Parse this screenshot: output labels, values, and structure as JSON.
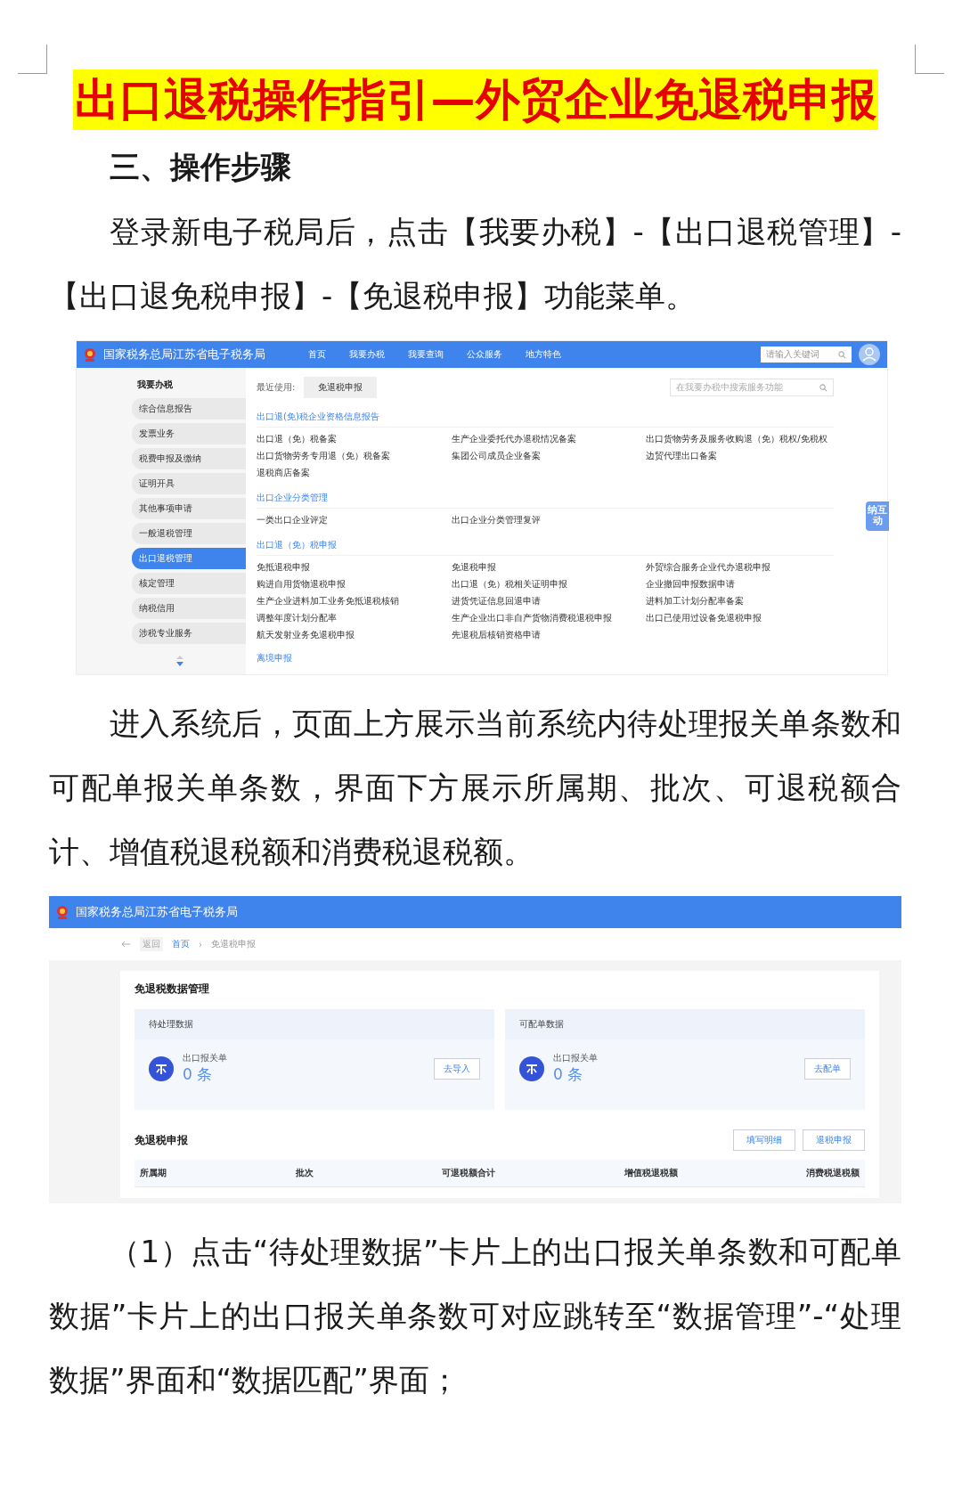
{
  "title": "出口退税操作指引—外贸企业免退税申报",
  "heading": "三、操作步骤",
  "paragraph_1": "登录新电子税局后，点击【我要办税】-【出口退税管理】-【出口退免税申报】-【免退税申报】功能菜单。",
  "screenshot_1": {
    "header": {
      "site_title": "国家税务总局江苏省电子税务局",
      "nav": [
        "首页",
        "我要办税",
        "我要查询",
        "公众服务",
        "地方特色"
      ],
      "search": {
        "placeholder": "请输入关键词"
      }
    },
    "sidebar": {
      "title": "我要办税",
      "items": [
        {
          "label": "综合信息报告",
          "selected": false
        },
        {
          "label": "发票业务",
          "selected": false
        },
        {
          "label": "税费申报及缴纳",
          "selected": false
        },
        {
          "label": "证明开具",
          "selected": false
        },
        {
          "label": "其他事项申请",
          "selected": false
        },
        {
          "label": "一般退税管理",
          "selected": false
        },
        {
          "label": "出口退税管理",
          "selected": true
        },
        {
          "label": "核定管理",
          "selected": false
        },
        {
          "label": "纳税信用",
          "selected": false
        },
        {
          "label": "涉税专业服务",
          "selected": false
        }
      ]
    },
    "recent": {
      "label": "最近使用:",
      "item": "免退税申报"
    },
    "search": {
      "placeholder": "在我要办税中搜索服务功能"
    },
    "sections": [
      {
        "title": "出口退(免)税企业资格信息报告",
        "items": [
          "出口退（免）税备案",
          "生产企业委托代办退税情况备案",
          "出口货物劳务及服务收购退（免）税权/免税权",
          "出口货物劳务专用退（免）税备案",
          "集团公司成员企业备案",
          "边贸代理出口备案",
          "退税商店备案"
        ]
      },
      {
        "title": "出口企业分类管理",
        "items": [
          "一类出口企业评定",
          "出口企业分类管理复评"
        ]
      },
      {
        "title": "出口退（免）税申报",
        "items": [
          "免抵退税申报",
          "免退税申报",
          "外贸综合服务企业代办退税申报",
          "购进自用货物退税申报",
          "出口退（免）税相关证明申报",
          "企业撤回申报数据申请",
          "生产企业进料加工业务免抵退税核销",
          "进货凭证信息回退申请",
          "进料加工计划分配率备案",
          "调整年度计划分配率",
          "生产企业出口非自产货物消费税退税申报",
          "出口已使用过设备免退税申报",
          "航天发射业务免退税申报",
          "先退税后核销资格申请"
        ]
      }
    ],
    "more_link": "离境申报",
    "float_badge": "纳互动"
  },
  "paragraph_2": "进入系统后，页面上方展示当前系统内待处理报关单条数和可配单报关单条数，界面下方展示所属期、批次、可退税额合计、增值税退税额和消费税退税额。",
  "screenshot_2": {
    "header": {
      "site_title": "国家税务总局江苏省电子税务局"
    },
    "breadcrumb": {
      "back": "返回",
      "separator": "›",
      "items": [
        "首页",
        "免退税申报"
      ]
    },
    "data_panel": {
      "title": "免退税数据管理",
      "cards": [
        {
          "title": "待处理数据",
          "label": "出口报关单",
          "count": "0 条",
          "button": "去导入"
        },
        {
          "title": "可配单数据",
          "label": "出口报关单",
          "count": "0 条",
          "button": "去配单"
        }
      ]
    },
    "declare": {
      "title": "免退税申报",
      "buttons": [
        "填写明细",
        "退税申报"
      ],
      "columns": [
        "所属期",
        "批次",
        "可退税额合计",
        "增值税退税额",
        "消费税退税额"
      ]
    }
  },
  "paragraph_3": "（1）点击“待处理数据”卡片上的出口报关单条数和可配单数据”卡片上的出口报关单条数可对应跳转至“数据管理”-“处理数据”界面和“数据匹配”界面；"
}
